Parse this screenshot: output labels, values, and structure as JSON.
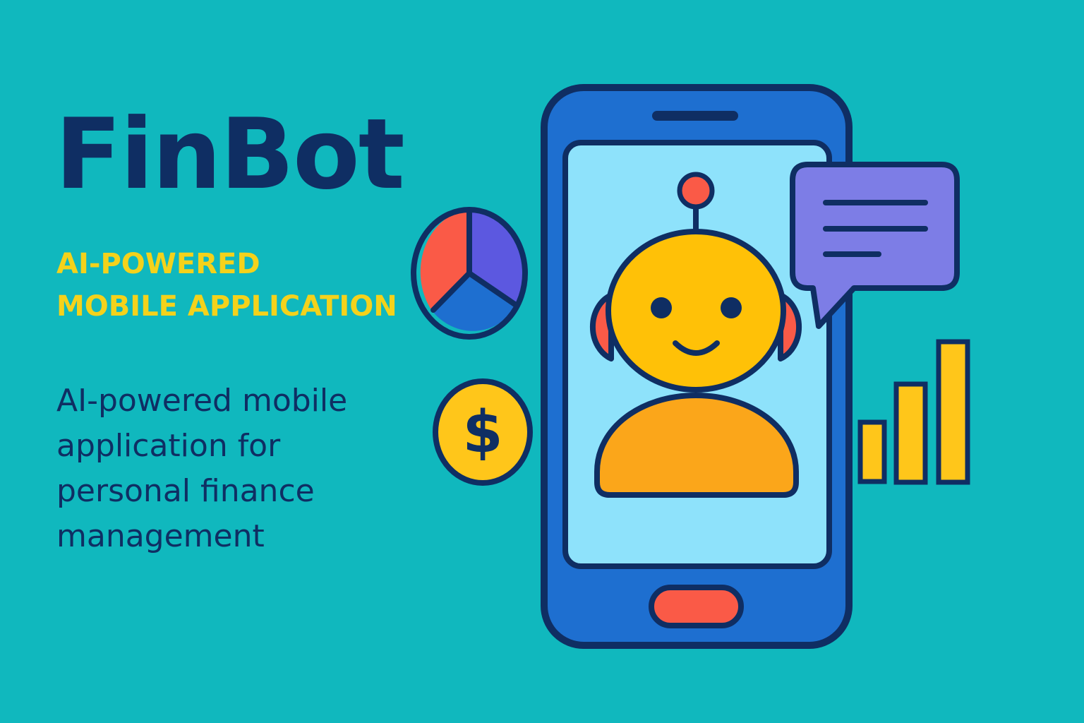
{
  "brand": {
    "name": "FinBot"
  },
  "tagline": {
    "line1": "AI-POWERED",
    "line2": "MOBILE APPLICATION"
  },
  "description": {
    "line1": "AI-powered mobile",
    "line2": "application for",
    "line3": "personal finance",
    "line4": "management"
  },
  "currency_symbol": "$",
  "colors": {
    "background": "#10b8be",
    "navy": "#0f2e63",
    "yellow": "#f4d21b",
    "phone_blue": "#1e6fd0",
    "screen_blue": "#8ee2fb",
    "robot_yellow": "#ffc107",
    "robot_body": "#fba61a",
    "accent_red": "#fa5a47",
    "bubble_purple": "#7d7de6"
  },
  "icons": [
    "pie-chart-icon",
    "dollar-coin-icon",
    "smartphone-icon",
    "robot-icon",
    "chat-bubble-icon",
    "bar-chart-icon"
  ]
}
